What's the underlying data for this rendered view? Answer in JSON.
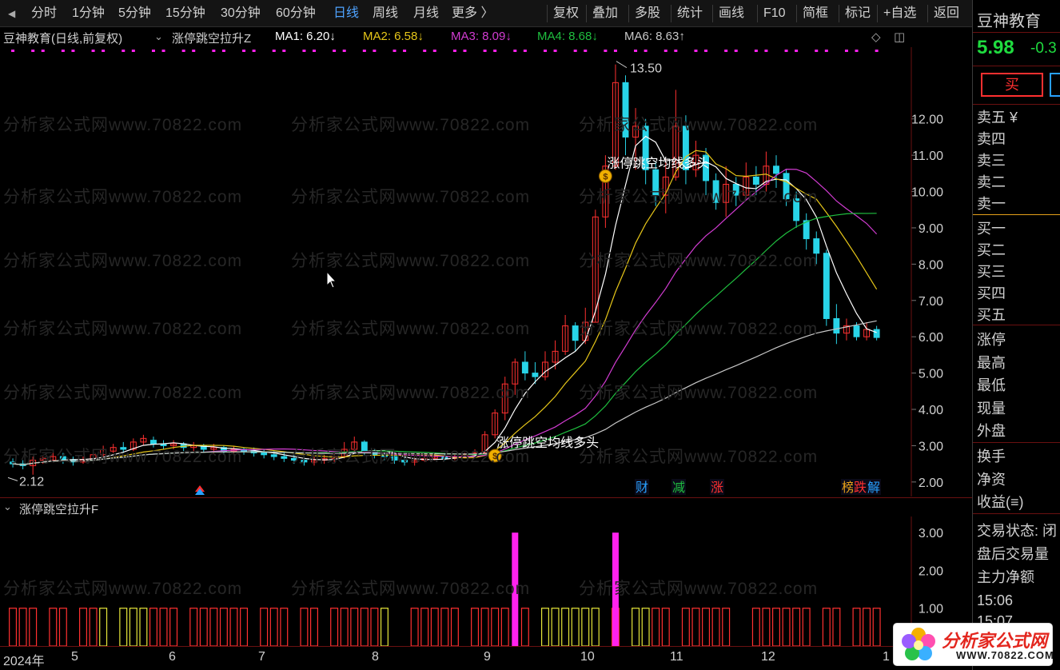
{
  "toolbar": {
    "periods": [
      "分时",
      "1分钟",
      "5分钟",
      "15分钟",
      "30分钟",
      "60分钟",
      "日线",
      "周线",
      "月线",
      "更多 〉"
    ],
    "active_period": "日线",
    "tools": [
      "复权",
      "叠加",
      "多股",
      "统计",
      "画线",
      "F10",
      "简框",
      "标记",
      "+自选",
      "返回"
    ]
  },
  "stock": {
    "name": "豆神教育",
    "price": "5.98",
    "change": "-0.3",
    "chart_label": "豆神教育(日线,前复权)",
    "buy_label": "买"
  },
  "indicator_main": "涨停跳空拉升Z",
  "indicator_sub": "涨停跳空拉升F",
  "ma": [
    {
      "label": "MA1: 6.20↓",
      "color": "#ffffff"
    },
    {
      "label": "MA2: 6.58↓",
      "color": "#e6c619"
    },
    {
      "label": "MA3: 8.09↓",
      "color": "#d23cd2"
    },
    {
      "label": "MA4: 8.68↓",
      "color": "#1fbf3f"
    },
    {
      "label": "MA6: 8.63↑",
      "color": "#c8c8c8"
    }
  ],
  "colors": {
    "up": "#ff3030",
    "down": "#28d4e8",
    "bg": "#000000",
    "grid": "#6a1010",
    "accent": "#4fa3ff",
    "bar_magenta": "#ff22ee",
    "bar_yellow": "#e6e63a"
  },
  "watermark": "分析家公式网www.70822.com",
  "annotations": {
    "high": "13.50",
    "low": "2.12",
    "signal_text": "涨停跳空均线多头",
    "event_badges": [
      "财",
      "减",
      "涨",
      "榜",
      "跌",
      "解"
    ]
  },
  "axes": {
    "price_ticks": [
      "12.00",
      "11.00",
      "10.00",
      "9.00",
      "8.00",
      "7.00",
      "6.00",
      "5.00",
      "4.00",
      "3.00",
      "2.00"
    ],
    "sub_ticks": [
      "3.00",
      "2.00",
      "1.00"
    ],
    "x_labels": [
      "2024年",
      "5",
      "6",
      "7",
      "8",
      "9",
      "10",
      "11",
      "12",
      "1"
    ]
  },
  "panel": {
    "sell": [
      "卖五 ¥",
      "卖四",
      "卖三",
      "卖二",
      "卖一"
    ],
    "buy": [
      "买一",
      "买二",
      "买三",
      "买四",
      "买五"
    ],
    "stats": [
      "涨停",
      "最高",
      "最低",
      "现量",
      "外盘"
    ],
    "stats2": [
      "换手",
      "净资",
      "收益(≡)"
    ],
    "trade": [
      "交易状态: 闭",
      "盘后交易量",
      "主力净额"
    ],
    "times": [
      "15:06",
      "15:07"
    ]
  },
  "logo": {
    "text": "分析家公式网",
    "url": "WWW.70822.COM"
  },
  "chart_data": {
    "type": "candlestick",
    "y_range": [
      1.6,
      13.8
    ],
    "candles": [
      [
        2.55,
        2.5,
        2.65,
        2.4
      ],
      [
        2.5,
        2.45,
        2.6,
        2.35
      ],
      [
        2.45,
        2.6,
        2.7,
        2.2
      ],
      [
        2.6,
        2.65,
        2.7,
        2.5
      ],
      [
        2.6,
        2.7,
        2.8,
        2.55
      ],
      [
        2.7,
        2.6,
        2.8,
        2.5
      ],
      [
        2.6,
        2.55,
        2.7,
        2.45
      ],
      [
        2.55,
        2.6,
        2.7,
        2.5
      ],
      [
        2.6,
        2.75,
        2.85,
        2.55
      ],
      [
        2.75,
        2.9,
        3.0,
        2.7
      ],
      [
        2.85,
        2.95,
        3.05,
        2.8
      ],
      [
        2.95,
        2.9,
        3.1,
        2.8
      ],
      [
        2.9,
        3.1,
        3.2,
        2.85
      ],
      [
        3.1,
        3.2,
        3.3,
        3.0
      ],
      [
        3.15,
        3.05,
        3.25,
        2.95
      ],
      [
        3.05,
        3.0,
        3.15,
        2.9
      ],
      [
        3.0,
        3.05,
        3.15,
        2.9
      ],
      [
        3.05,
        2.95,
        3.1,
        2.85
      ],
      [
        2.95,
        3.0,
        3.1,
        2.85
      ],
      [
        3.0,
        2.9,
        3.05,
        2.8
      ],
      [
        2.9,
        2.95,
        3.05,
        2.8
      ],
      [
        2.95,
        2.85,
        3.0,
        2.75
      ],
      [
        2.85,
        2.9,
        3.0,
        2.8
      ],
      [
        2.9,
        2.85,
        2.95,
        2.75
      ],
      [
        2.85,
        2.8,
        2.95,
        2.7
      ],
      [
        2.8,
        2.75,
        2.9,
        2.65
      ],
      [
        2.75,
        2.7,
        2.85,
        2.6
      ],
      [
        2.7,
        2.65,
        2.8,
        2.55
      ],
      [
        2.65,
        2.6,
        2.75,
        2.5
      ],
      [
        2.6,
        2.55,
        2.7,
        2.45
      ],
      [
        2.55,
        2.6,
        2.7,
        2.45
      ],
      [
        2.6,
        2.65,
        2.75,
        2.5
      ],
      [
        2.65,
        2.7,
        2.8,
        2.55
      ],
      [
        2.7,
        2.9,
        3.1,
        2.65
      ],
      [
        2.9,
        3.1,
        3.25,
        2.85
      ],
      [
        3.1,
        2.85,
        3.15,
        2.75
      ],
      [
        2.85,
        2.75,
        2.9,
        2.65
      ],
      [
        2.75,
        2.7,
        2.8,
        2.6
      ],
      [
        2.7,
        2.6,
        2.75,
        2.5
      ],
      [
        2.6,
        2.55,
        2.7,
        2.45
      ],
      [
        2.55,
        2.6,
        2.7,
        2.45
      ],
      [
        2.6,
        2.65,
        2.75,
        2.55
      ],
      [
        2.65,
        2.7,
        2.8,
        2.6
      ],
      [
        2.7,
        2.65,
        2.8,
        2.6
      ],
      [
        2.65,
        2.7,
        2.75,
        2.6
      ],
      [
        2.7,
        2.75,
        2.8,
        2.65
      ],
      [
        2.75,
        2.8,
        2.9,
        2.7
      ],
      [
        2.8,
        3.3,
        3.4,
        2.75
      ],
      [
        3.3,
        3.9,
        4.0,
        3.2
      ],
      [
        3.9,
        4.7,
        4.9,
        3.7
      ],
      [
        4.7,
        5.3,
        5.4,
        4.4
      ],
      [
        5.3,
        5.0,
        5.6,
        4.8
      ],
      [
        5.0,
        4.9,
        5.3,
        4.7
      ],
      [
        4.9,
        5.3,
        5.6,
        4.8
      ],
      [
        5.3,
        5.6,
        5.9,
        5.1
      ],
      [
        5.6,
        6.3,
        6.6,
        5.5
      ],
      [
        6.3,
        5.9,
        6.4,
        5.6
      ],
      [
        5.9,
        6.4,
        6.8,
        5.8
      ],
      [
        6.4,
        9.3,
        9.5,
        6.4
      ],
      [
        9.3,
        10.7,
        11.0,
        9.0
      ],
      [
        10.7,
        13.0,
        13.5,
        10.6
      ],
      [
        13.0,
        11.5,
        13.2,
        11.0
      ],
      [
        11.5,
        11.8,
        12.3,
        10.6
      ],
      [
        11.8,
        10.6,
        12.0,
        10.2
      ],
      [
        10.6,
        9.9,
        10.8,
        9.6
      ],
      [
        9.9,
        10.4,
        10.9,
        9.4
      ],
      [
        10.4,
        11.8,
        12.8,
        10.3
      ],
      [
        11.8,
        10.6,
        12.1,
        10.2
      ],
      [
        10.6,
        11.0,
        11.4,
        10.4
      ],
      [
        11.0,
        10.3,
        11.2,
        9.9
      ],
      [
        10.3,
        9.7,
        10.5,
        9.5
      ],
      [
        9.7,
        10.2,
        10.7,
        9.3
      ],
      [
        10.2,
        9.9,
        10.4,
        9.6
      ],
      [
        9.9,
        10.4,
        10.8,
        9.8
      ],
      [
        10.4,
        10.2,
        10.7,
        9.9
      ],
      [
        10.2,
        10.7,
        11.1,
        10.0
      ],
      [
        10.7,
        10.5,
        11.0,
        10.1
      ],
      [
        10.5,
        9.8,
        10.6,
        9.6
      ],
      [
        9.8,
        9.2,
        10.0,
        9.0
      ],
      [
        9.2,
        8.7,
        9.4,
        8.4
      ],
      [
        8.7,
        8.3,
        8.9,
        8.0
      ],
      [
        8.3,
        6.5,
        8.4,
        6.3
      ],
      [
        6.5,
        6.1,
        6.9,
        5.8
      ],
      [
        6.1,
        6.3,
        6.5,
        5.9
      ],
      [
        6.3,
        6.0,
        6.4,
        5.9
      ],
      [
        6.0,
        6.2,
        6.4,
        5.9
      ],
      [
        6.2,
        5.98,
        6.3,
        5.9
      ]
    ],
    "ma_series": [
      {
        "name": "MA1",
        "color": "#ffffff",
        "period": 5
      },
      {
        "name": "MA2",
        "color": "#e6c619",
        "period": 10
      },
      {
        "name": "MA3",
        "color": "#d23cd2",
        "period": 20
      },
      {
        "name": "MA4",
        "color": "#1fbf3f",
        "period": 30
      },
      {
        "name": "MA6",
        "color": "#c8c8c8",
        "period": 60
      }
    ],
    "sub": {
      "type": "bar",
      "y_range": [
        0,
        3.3
      ],
      "spikes": [
        3,
        3
      ],
      "spike_days": [
        50,
        60
      ]
    }
  }
}
